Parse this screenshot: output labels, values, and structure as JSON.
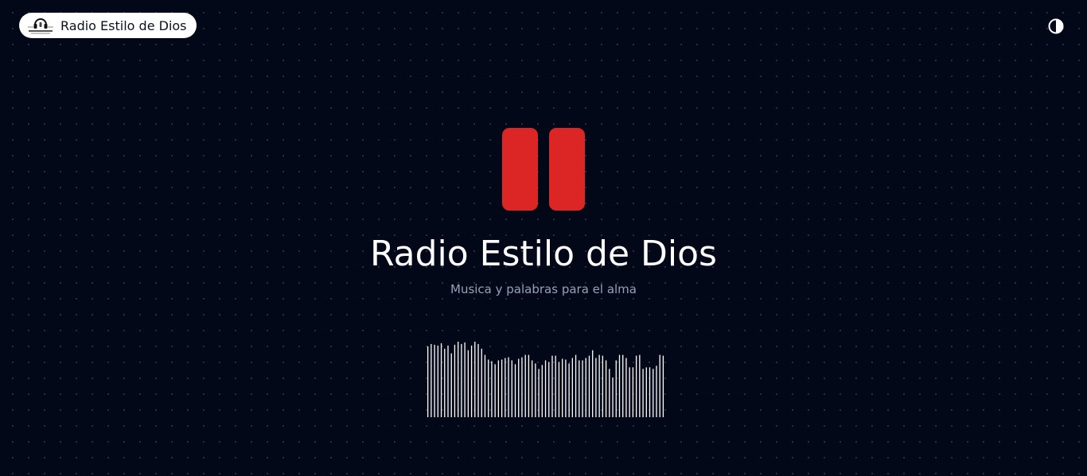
{
  "header": {
    "brand_name": "Radio Estilo de Dios",
    "logo_icon": "headphones-logo-icon",
    "theme_toggle_icon": "contrast-half-circle-icon"
  },
  "player": {
    "state": "playing",
    "control_icon": "pause-icon",
    "accent_color": "#dc2626",
    "title": "Radio Estilo de Dios",
    "subtitle": "Musica y palabras para el alma"
  },
  "visualizer": {
    "bar_color": "#ffffff",
    "levels": [
      0.91,
      0.94,
      0.93,
      0.92,
      0.95,
      0.88,
      0.92,
      0.82,
      0.93,
      0.97,
      0.94,
      0.96,
      0.86,
      0.92,
      0.97,
      0.94,
      0.88,
      0.8,
      0.74,
      0.72,
      0.68,
      0.73,
      0.74,
      0.76,
      0.77,
      0.73,
      0.68,
      0.75,
      0.77,
      0.8,
      0.8,
      0.73,
      0.69,
      0.62,
      0.67,
      0.73,
      0.71,
      0.79,
      0.79,
      0.71,
      0.75,
      0.74,
      0.69,
      0.76,
      0.8,
      0.73,
      0.73,
      0.76,
      0.79,
      0.86,
      0.76,
      0.8,
      0.79,
      0.73,
      0.62,
      0.51,
      0.73,
      0.8,
      0.8,
      0.76,
      0.64,
      0.64,
      0.79,
      0.8,
      0.62,
      0.64,
      0.64,
      0.62,
      0.66,
      0.8,
      0.79
    ]
  },
  "colors": {
    "background": "#020817",
    "text": "#ffffff",
    "muted_text": "#94a3b8",
    "pill_background": "#ffffff"
  }
}
